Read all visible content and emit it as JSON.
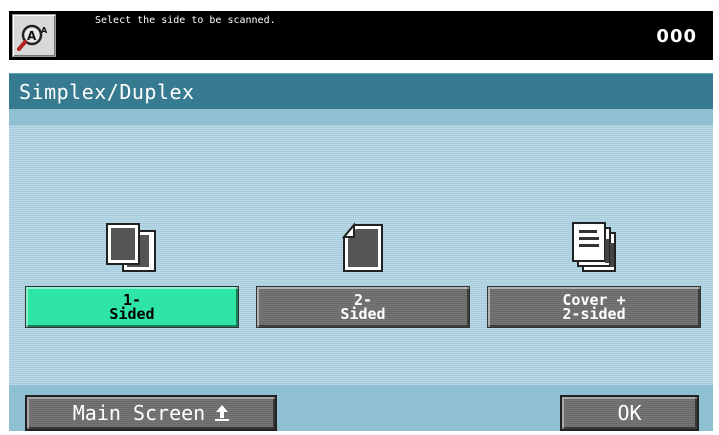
{
  "header": {
    "help_icon": "accessibility-magnifier-icon",
    "message": "Select the side to be scanned.",
    "counter": "000"
  },
  "screen": {
    "title": "Simplex/Duplex"
  },
  "options": [
    {
      "label": "1-\nSided",
      "icon": "single-sided-pages-icon",
      "selected": true
    },
    {
      "label": "2-\nSided",
      "icon": "double-sided-page-icon",
      "selected": false
    },
    {
      "label": "Cover +\n2-sided",
      "icon": "cover-stack-icon",
      "selected": false
    }
  ],
  "footer": {
    "main_screen_label": "Main Screen",
    "main_screen_icon": "up-arrow-icon",
    "ok_label": "OK"
  },
  "colors": {
    "title_bar": "#377b91",
    "panel": "#a6cddd",
    "selected": "#2fe5a6",
    "button": "#6a6a6a"
  }
}
